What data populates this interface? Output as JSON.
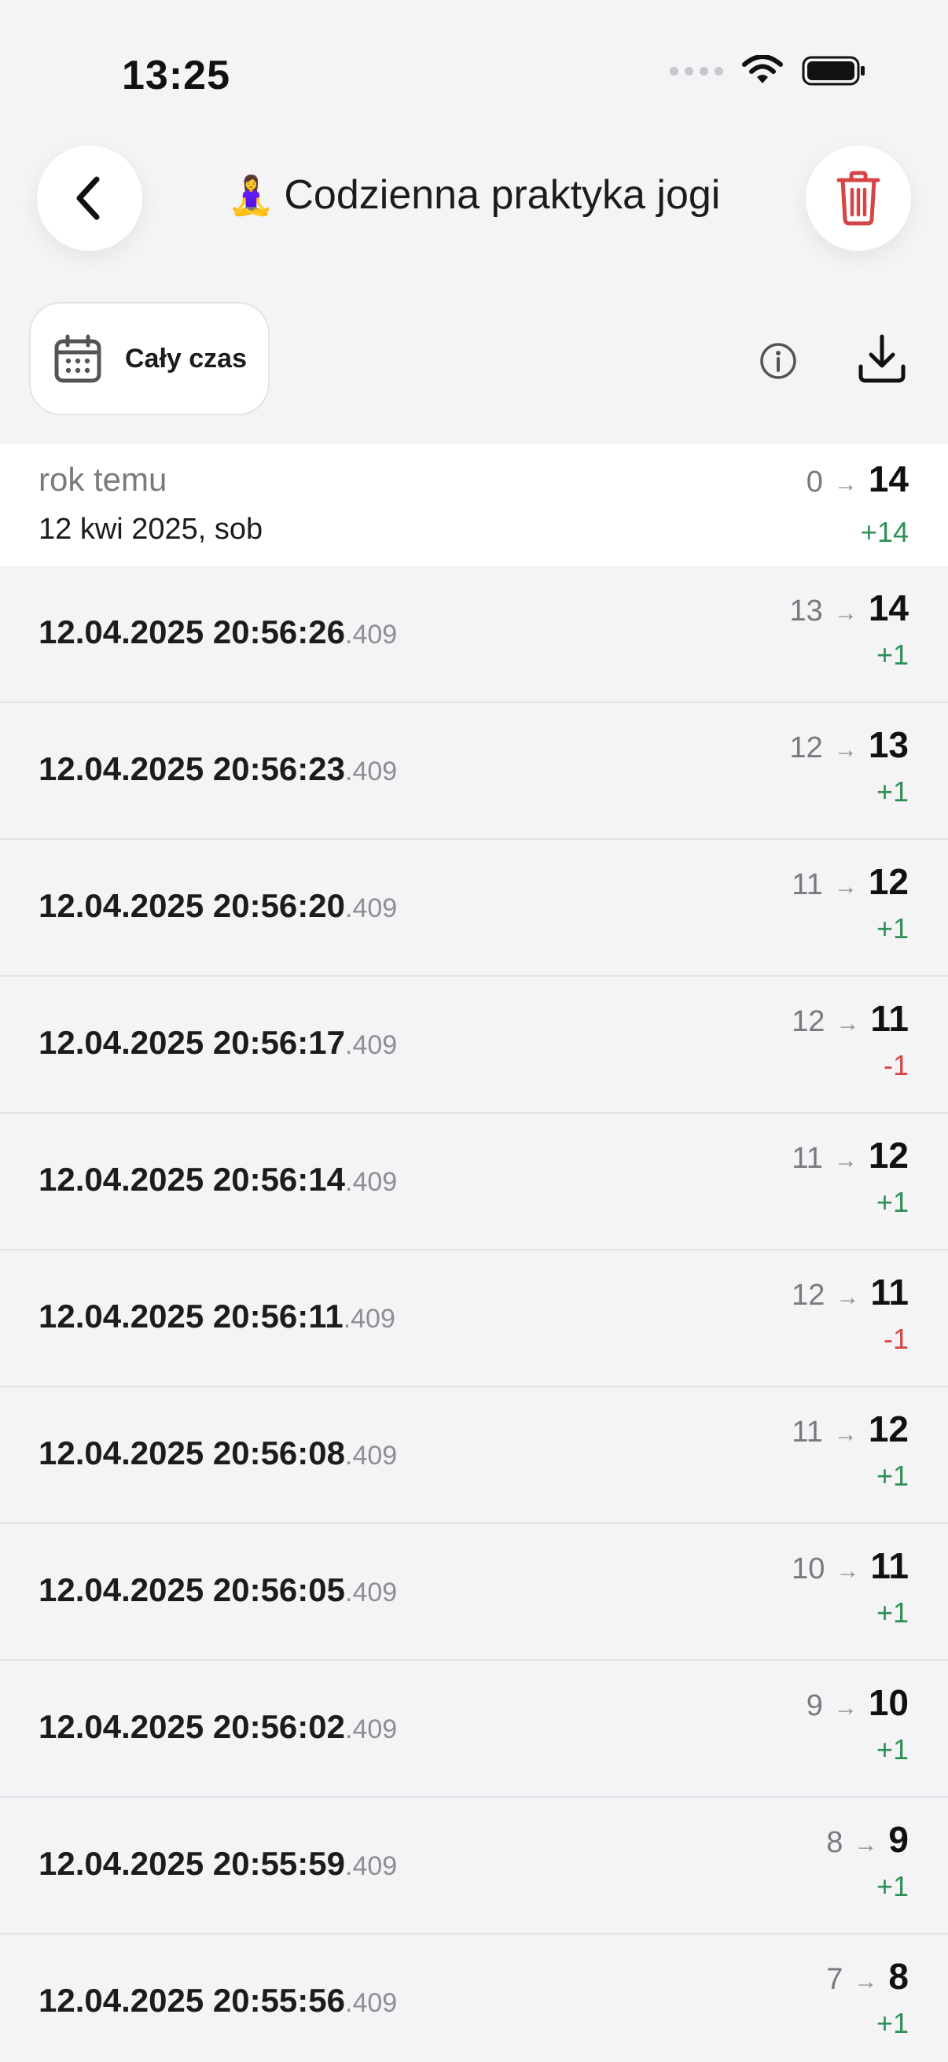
{
  "status_bar": {
    "time": "13:25"
  },
  "header": {
    "title_emoji": "🧘‍♀️",
    "title": "Codzienna praktyka jogi"
  },
  "toolbar": {
    "period_label": "Cały czas"
  },
  "summary": {
    "relative": "rok temu",
    "date": "12 kwi 2025, sob",
    "from": "0",
    "to": "14",
    "delta": "+14",
    "delta_sign": "pos"
  },
  "entries": [
    {
      "time": "12.04.2025 20:56:26",
      "ms": ".409",
      "from": "13",
      "to": "14",
      "delta": "+1",
      "sign": "pos"
    },
    {
      "time": "12.04.2025 20:56:23",
      "ms": ".409",
      "from": "12",
      "to": "13",
      "delta": "+1",
      "sign": "pos"
    },
    {
      "time": "12.04.2025 20:56:20",
      "ms": ".409",
      "from": "11",
      "to": "12",
      "delta": "+1",
      "sign": "pos"
    },
    {
      "time": "12.04.2025 20:56:17",
      "ms": ".409",
      "from": "12",
      "to": "11",
      "delta": "-1",
      "sign": "neg"
    },
    {
      "time": "12.04.2025 20:56:14",
      "ms": ".409",
      "from": "11",
      "to": "12",
      "delta": "+1",
      "sign": "pos"
    },
    {
      "time": "12.04.2025 20:56:11",
      "ms": ".409",
      "from": "12",
      "to": "11",
      "delta": "-1",
      "sign": "neg"
    },
    {
      "time": "12.04.2025 20:56:08",
      "ms": ".409",
      "from": "11",
      "to": "12",
      "delta": "+1",
      "sign": "pos"
    },
    {
      "time": "12.04.2025 20:56:05",
      "ms": ".409",
      "from": "10",
      "to": "11",
      "delta": "+1",
      "sign": "pos"
    },
    {
      "time": "12.04.2025 20:56:02",
      "ms": ".409",
      "from": "9",
      "to": "10",
      "delta": "+1",
      "sign": "pos"
    },
    {
      "time": "12.04.2025 20:55:59",
      "ms": ".409",
      "from": "8",
      "to": "9",
      "delta": "+1",
      "sign": "pos"
    },
    {
      "time": "12.04.2025 20:55:56",
      "ms": ".409",
      "from": "7",
      "to": "8",
      "delta": "+1",
      "sign": "pos"
    }
  ],
  "icons": {
    "back": "chevron-left-icon",
    "delete": "trash-icon",
    "calendar": "calendar-icon",
    "info": "info-icon",
    "download": "download-icon",
    "arrow": "arrow-right-icon"
  },
  "colors": {
    "positive": "#2f8f57",
    "negative": "#d64545",
    "delete": "#d64545",
    "background": "#f4f4f6"
  }
}
